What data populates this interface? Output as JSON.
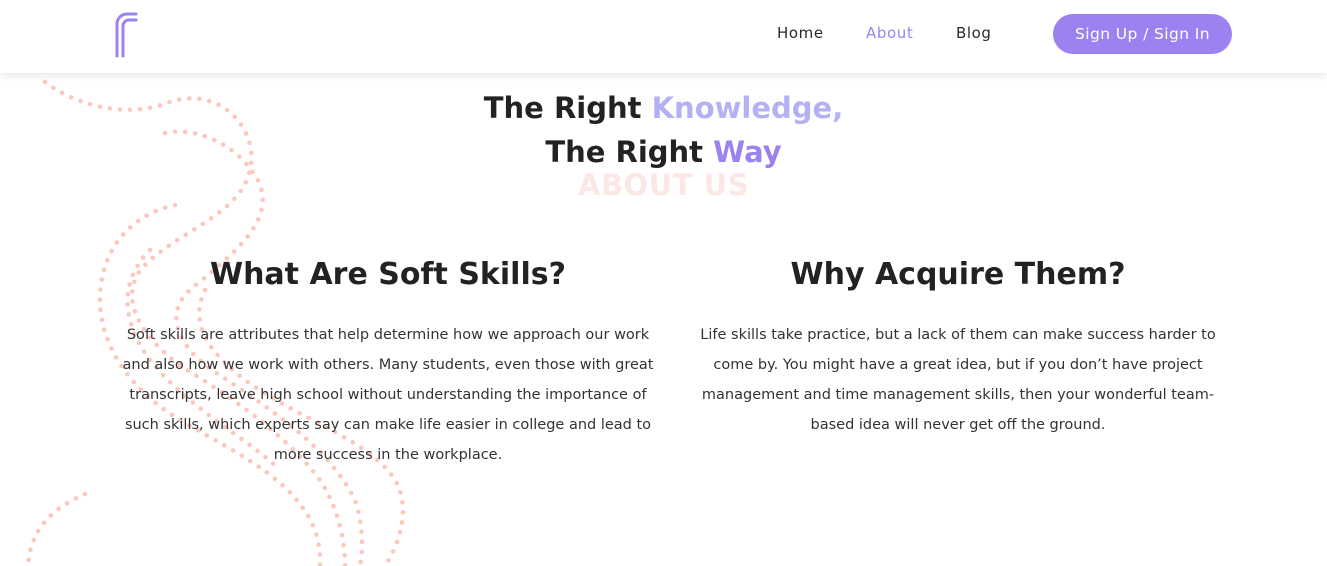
{
  "header": {
    "logo_icon": "brand-logo-icon",
    "nav": [
      {
        "label": "Home",
        "active": false
      },
      {
        "label": "About",
        "active": true
      },
      {
        "label": "Blog",
        "active": false
      }
    ],
    "signin_label": "Sign Up / Sign In"
  },
  "hero": {
    "line1_prefix": "The Right ",
    "line1_highlight": "Knowledge,",
    "line2_prefix": "The Right ",
    "line2_highlight": "Way",
    "watermark": "ABOUT US"
  },
  "columns": [
    {
      "title": "What Are Soft Skills?",
      "text": "Soft skills are attributes that help determine how we approach our work and also how we work with others. Many students, even those with great transcripts, leave high school without understanding the importance of such skills, which experts say can make life easier in college and lead to more success in the workplace."
    },
    {
      "title": "Why Acquire Them?",
      "text": "Life skills take practice, but a lack of them can make success harder to come by. You might have a great idea, but if you don’t have project management and time management skills, then your wonderful team-based idea will never get off the ground."
    }
  ],
  "colors": {
    "accent": "#9b82f0",
    "accent_light": "#b3b1f4",
    "decor_dots": "#fcc7bd",
    "watermark": "#fde7e5"
  }
}
